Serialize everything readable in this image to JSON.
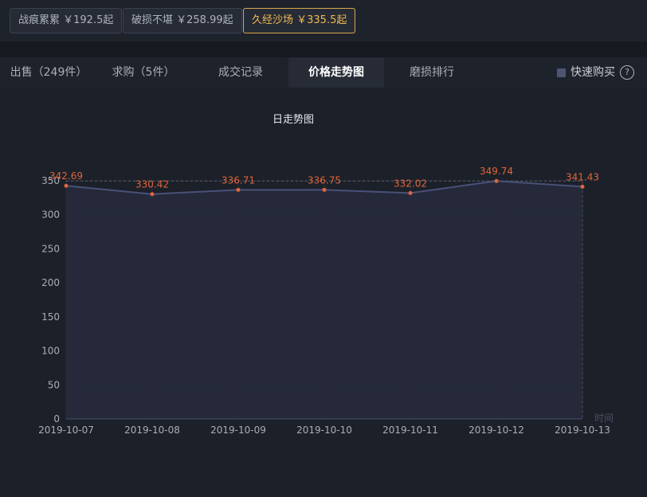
{
  "wear_buttons": [
    {
      "label": "战痕累累 ￥192.5起",
      "active": false
    },
    {
      "label": "破损不堪 ￥258.99起",
      "active": false
    },
    {
      "label": "久经沙场 ￥335.5起",
      "active": true
    }
  ],
  "tabs": [
    {
      "label": "出售（249件）",
      "active": false
    },
    {
      "label": "求购（5件）",
      "active": false
    },
    {
      "label": "成交记录",
      "active": false
    },
    {
      "label": "价格走势图",
      "active": true
    },
    {
      "label": "磨损排行",
      "active": false
    }
  ],
  "quick_buy": {
    "label": "快速购买",
    "help_icon": "question-circle-icon"
  },
  "colors": {
    "accent_gold": "#f0b94e",
    "data_label": "#e2653a",
    "line": "#4a5178",
    "area": "#262a3b"
  },
  "chart_data": {
    "type": "area",
    "title": "日走势图",
    "x": [
      "2019-10-07",
      "2019-10-08",
      "2019-10-09",
      "2019-10-10",
      "2019-10-11",
      "2019-10-12",
      "2019-10-13"
    ],
    "values": [
      342.69,
      330.42,
      336.71,
      336.75,
      332.02,
      349.74,
      341.43
    ],
    "value_labels": [
      "342.69",
      "330.42",
      "336.71",
      "336.75",
      "332.02",
      "349.74",
      "341.43"
    ],
    "xlabel": "时间",
    "ylabel": "",
    "ylim": [
      0,
      350
    ],
    "yticks": [
      0,
      50,
      100,
      150,
      200,
      250,
      300,
      350
    ],
    "grid": true,
    "max_line": 349.74
  }
}
